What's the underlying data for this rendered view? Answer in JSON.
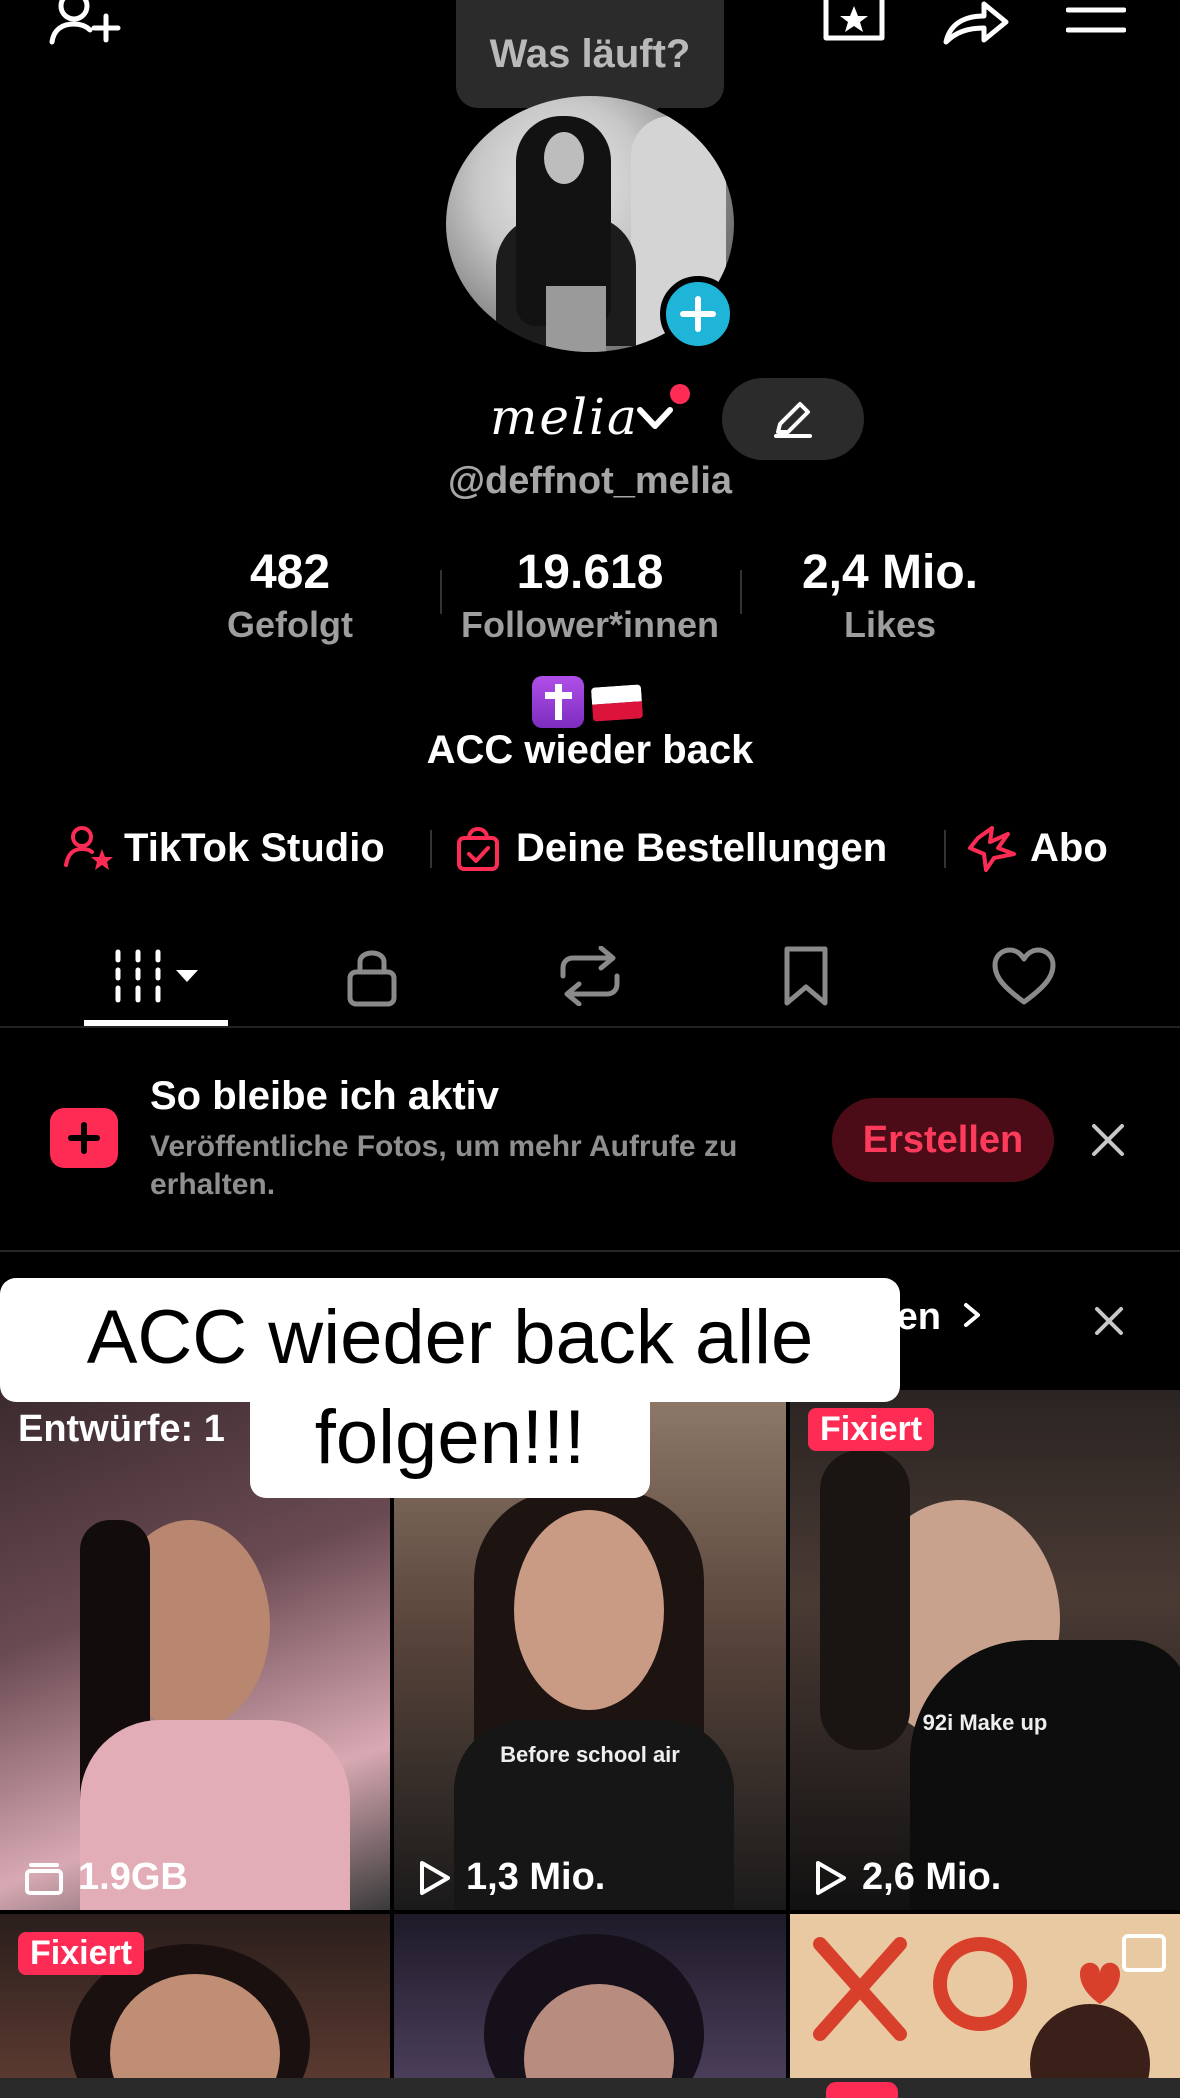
{
  "header": {
    "bubble_text": "Was läuft?"
  },
  "profile": {
    "display_name": "melia",
    "handle": "@deffnot_melia",
    "bio": "ACC wieder back"
  },
  "stats": [
    {
      "value": "482",
      "label": "Gefolgt"
    },
    {
      "value": "19.618",
      "label": "Follower*innen"
    },
    {
      "value": "2,4 Mio.",
      "label": "Likes"
    }
  ],
  "links": {
    "studio": "TikTok Studio",
    "orders": "Deine Bestellungen",
    "abo": "Abo"
  },
  "promo": {
    "title": "So bleibe ich aktiv",
    "description": "Veröffentliche Fotos, um mehr Aufrufe zu erhalten.",
    "button": "Erstellen"
  },
  "hidden_row_text": "ten",
  "sticker": {
    "line1": "ACC wieder back alle",
    "line2": "folgen!!!"
  },
  "grid": [
    {
      "top_label": "Entwürfe: 1",
      "bottom": "1.9GB",
      "bottom_icon": "drafts-icon"
    },
    {
      "overlay": "Before school air",
      "bottom": "1,3 Mio.",
      "bottom_icon": "play-icon"
    },
    {
      "pin": "Fixiert",
      "overlay": "92i Make up",
      "bottom": "2,6 Mio.",
      "bottom_icon": "play-icon"
    },
    {
      "pin": "Fixiert"
    },
    {},
    {}
  ],
  "colors": {
    "accent": "#fe2c55",
    "plus_badge": "#1fb5d9",
    "background": "#000000"
  }
}
